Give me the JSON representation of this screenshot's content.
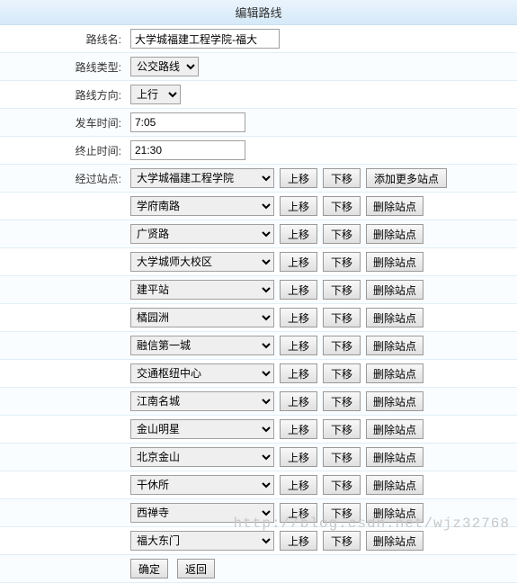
{
  "header": {
    "title": "编辑路线"
  },
  "fields": {
    "routeName": {
      "label": "路线名:",
      "value": "大学城福建工程学院-福大"
    },
    "routeType": {
      "label": "路线类型:",
      "value": "公交路线"
    },
    "direction": {
      "label": "路线方向:",
      "value": "上行"
    },
    "startTime": {
      "label": "发车时间:",
      "value": "7:05"
    },
    "endTime": {
      "label": "终止时间:",
      "value": "21:30"
    },
    "stopsLabel": "经过站点:"
  },
  "buttons": {
    "moveUp": "上移",
    "moveDown": "下移",
    "addMore": "添加更多站点",
    "delete": "删除站点",
    "confirm": "确定",
    "back": "返回"
  },
  "stations": [
    "大学城福建工程学院",
    "学府南路",
    "广贤路",
    "大学城师大校区",
    "建平站",
    "橘园洲",
    "融信第一城",
    "交通枢纽中心",
    "江南名城",
    "金山明星",
    "北京金山",
    "干休所",
    "西禅寺",
    "福大东门"
  ],
  "watermark": "http://blog.csdn.net/wjz32768"
}
